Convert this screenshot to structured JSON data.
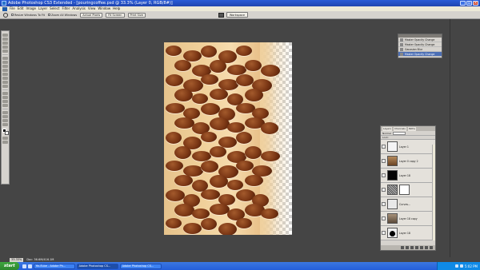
{
  "window": {
    "title": "Adobe Photoshop CS3 Extended - [pouringcoffee.psd @ 33.3% (Layer 0, RGB/8#)]"
  },
  "menu": [
    "File",
    "Edit",
    "Image",
    "Layer",
    "Select",
    "Filter",
    "Analysis",
    "View",
    "Window",
    "Help"
  ],
  "options_bar": {
    "resize_windows_label": "Resize Windows To Fit",
    "zoom_all_label": "Zoom All Windows",
    "actual_pixels_label": "Actual Pixels",
    "fit_screen_label": "Fit Screen",
    "print_size_label": "Print Size",
    "workspace_label": "Workspace"
  },
  "history": {
    "items": [
      {
        "label": "Master Opacity Change",
        "active": false
      },
      {
        "label": "Master Opacity Change",
        "active": false
      },
      {
        "label": "Gaussian Blur",
        "active": false
      },
      {
        "label": "Master Opacity Change",
        "active": true
      }
    ]
  },
  "layers": {
    "tabs": [
      "Layers",
      "Channels",
      "Paths"
    ],
    "blend_mode": "Normal",
    "lock_label": "Lock:",
    "rows": [
      {
        "name": "Layer 1",
        "thumb": "light"
      },
      {
        "name": "Layer 0 copy 2",
        "thumb": "mid"
      },
      {
        "name": "Layer 18",
        "thumb": "dark"
      },
      {
        "name": "",
        "thumb": "noise"
      },
      {
        "name": "Curves...",
        "thumb": "light"
      },
      {
        "name": "Layer 18 copy",
        "thumb": "mid"
      },
      {
        "name": "Layer 18",
        "thumb": "dark"
      }
    ]
  },
  "status": {
    "zoom": "33.33%",
    "doc": "Doc: 36.6M/416.1M"
  },
  "taskbar": {
    "start_label": "start",
    "tasks": [
      {
        "label": "YouTube - Adobe Ph...",
        "active": false
      },
      {
        "label": "Adobe Photoshop CS...",
        "active": true
      },
      {
        "label": "Adobe Photoshop CS...",
        "active": false
      }
    ],
    "clock": "5:02 PM"
  }
}
